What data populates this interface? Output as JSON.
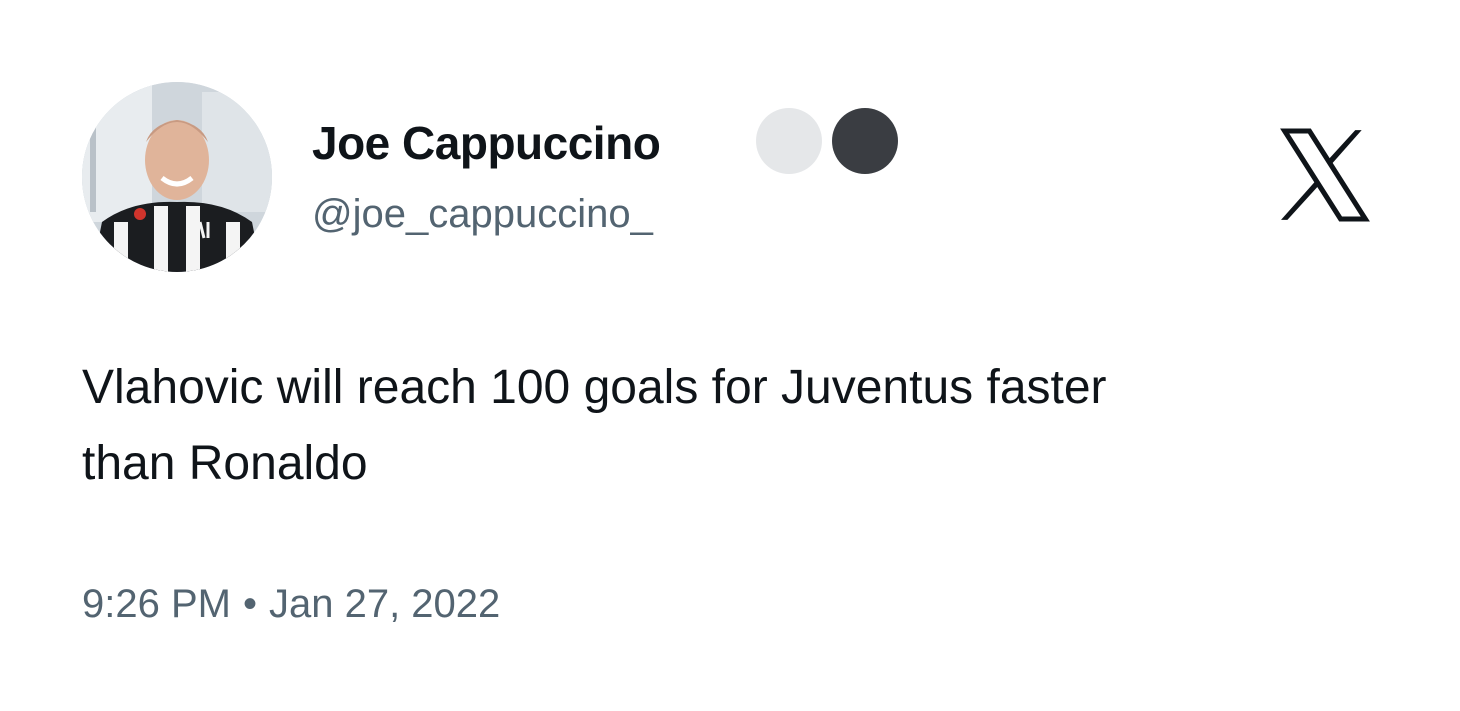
{
  "author": {
    "display_name": "Joe Cappuccino",
    "handle": "@joe_cappuccino_",
    "avatar_icon": "profile-photo",
    "badges": [
      {
        "icon": "light-circle-badge",
        "color": "#e5e7e9"
      },
      {
        "icon": "dark-circle-badge",
        "color": "#3a3d42"
      }
    ]
  },
  "brand": {
    "icon": "x-logo-icon",
    "color": "#0f1419"
  },
  "tweet": {
    "text": "Vlahovic will reach 100 goals for Juventus faster\nthan Ronaldo",
    "time": "9:26 PM",
    "separator": "•",
    "date": "Jan 27, 2022"
  },
  "colors": {
    "text_primary": "#0f1419",
    "text_secondary": "#536471",
    "background": "#ffffff"
  }
}
